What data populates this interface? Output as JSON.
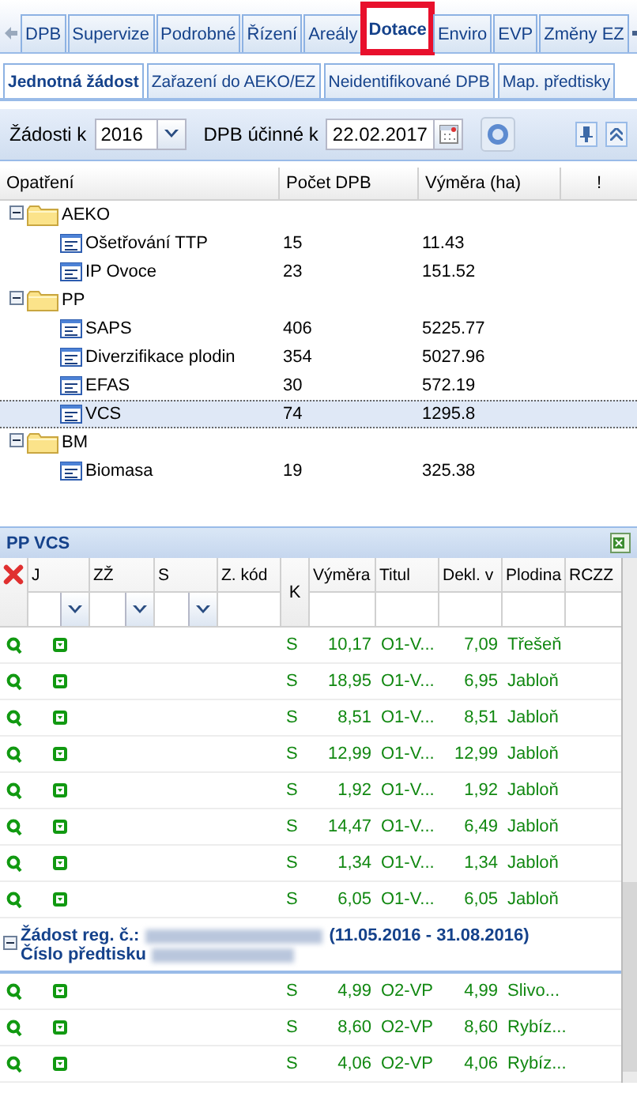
{
  "top_tabs": [
    {
      "label": "DPB",
      "selected": false,
      "highlighted": false
    },
    {
      "label": "Supervize",
      "selected": false,
      "highlighted": false
    },
    {
      "label": "Podrobné",
      "selected": false,
      "highlighted": false
    },
    {
      "label": "Řízení",
      "selected": false,
      "highlighted": false
    },
    {
      "label": "Areály",
      "selected": false,
      "highlighted": false
    },
    {
      "label": "Dotace",
      "selected": true,
      "highlighted": true
    },
    {
      "label": "Enviro",
      "selected": false,
      "highlighted": false
    },
    {
      "label": "EVP",
      "selected": false,
      "highlighted": false
    },
    {
      "label": "Změny EZ",
      "selected": false,
      "highlighted": false
    }
  ],
  "sub_tabs": [
    {
      "label": "Jednotná žádost",
      "selected": true
    },
    {
      "label": "Zařazení do AEKO/EZ",
      "selected": false
    },
    {
      "label": "Neidentifikované DPB",
      "selected": false
    },
    {
      "label": "Map. předtisky",
      "selected": false
    }
  ],
  "toolbar": {
    "year_label": "Žádosti k",
    "year_value": "2016",
    "date_label": "DPB účinné k",
    "date_value": "22.02.2017"
  },
  "tree": {
    "columns": [
      "Opatření",
      "Počet DPB",
      "Výměra (ha)",
      "!"
    ],
    "items": [
      {
        "kind": "folder",
        "label": "AEKO",
        "expanded": true,
        "selected": false,
        "children": [
          {
            "kind": "leaf",
            "label": "Ošetřování TTP",
            "count": "15",
            "area": "11.43",
            "selected": false
          },
          {
            "kind": "leaf",
            "label": "IP Ovoce",
            "count": "23",
            "area": "151.52",
            "selected": false
          }
        ]
      },
      {
        "kind": "folder",
        "label": "PP",
        "expanded": true,
        "selected": false,
        "children": [
          {
            "kind": "leaf",
            "label": "SAPS",
            "count": "406",
            "area": "5225.77",
            "selected": false
          },
          {
            "kind": "leaf",
            "label": "Diverzifikace plodin",
            "count": "354",
            "area": "5027.96",
            "selected": false
          },
          {
            "kind": "leaf",
            "label": "EFAS",
            "count": "30",
            "area": "572.19",
            "selected": false
          },
          {
            "kind": "leaf",
            "label": "VCS",
            "count": "74",
            "area": "1295.8",
            "selected": true
          }
        ]
      },
      {
        "kind": "folder",
        "label": "BM",
        "expanded": true,
        "selected": false,
        "children": [
          {
            "kind": "leaf",
            "label": "Biomasa",
            "count": "19",
            "area": "325.38",
            "selected": false
          }
        ]
      }
    ]
  },
  "panel": {
    "title": "PP VCS",
    "columns": [
      {
        "label": "J",
        "kind": "dropdown"
      },
      {
        "label": "ZŽ",
        "kind": "dropdown"
      },
      {
        "label": "S",
        "kind": "dropdown"
      },
      {
        "label": "Z. kód",
        "kind": "text"
      },
      {
        "label": "K",
        "kind": "plain"
      },
      {
        "label": "Výměra",
        "kind": "text"
      },
      {
        "label": "Titul",
        "kind": "text"
      },
      {
        "label": "Dekl. v",
        "kind": "text"
      },
      {
        "label": "Plodina",
        "kind": "text"
      },
      {
        "label": "RCZZ",
        "kind": "text"
      }
    ],
    "rows": [
      {
        "k": "S",
        "area": "10,17",
        "title": "O1-V...",
        "declared": "7,09",
        "crop": "Třešeň"
      },
      {
        "k": "S",
        "area": "18,95",
        "title": "O1-V...",
        "declared": "6,95",
        "crop": "Jabloň"
      },
      {
        "k": "S",
        "area": "8,51",
        "title": "O1-V...",
        "declared": "8,51",
        "crop": "Jabloň"
      },
      {
        "k": "S",
        "area": "12,99",
        "title": "O1-V...",
        "declared": "12,99",
        "crop": "Jabloň"
      },
      {
        "k": "S",
        "area": "1,92",
        "title": "O1-V...",
        "declared": "1,92",
        "crop": "Jabloň"
      },
      {
        "k": "S",
        "area": "14,47",
        "title": "O1-V...",
        "declared": "6,49",
        "crop": "Jabloň"
      },
      {
        "k": "S",
        "area": "1,34",
        "title": "O1-V...",
        "declared": "1,34",
        "crop": "Jabloň"
      },
      {
        "k": "S",
        "area": "6,05",
        "title": "O1-V...",
        "declared": "6,05",
        "crop": "Jabloň"
      }
    ],
    "group": {
      "label": "Žádost reg. č.:",
      "period": "(11.05.2016 - 31.08.2016)",
      "sub_label": "Číslo předtisku",
      "expanded": true,
      "rows": [
        {
          "k": "S",
          "area": "4,99",
          "title": "O2-VP",
          "declared": "4,99",
          "crop": "Slivo..."
        },
        {
          "k": "S",
          "area": "8,60",
          "title": "O2-VP",
          "declared": "8,60",
          "crop": "Rybíz..."
        },
        {
          "k": "S",
          "area": "4,06",
          "title": "O2-VP",
          "declared": "4,06",
          "crop": "Rybíz..."
        }
      ]
    }
  }
}
